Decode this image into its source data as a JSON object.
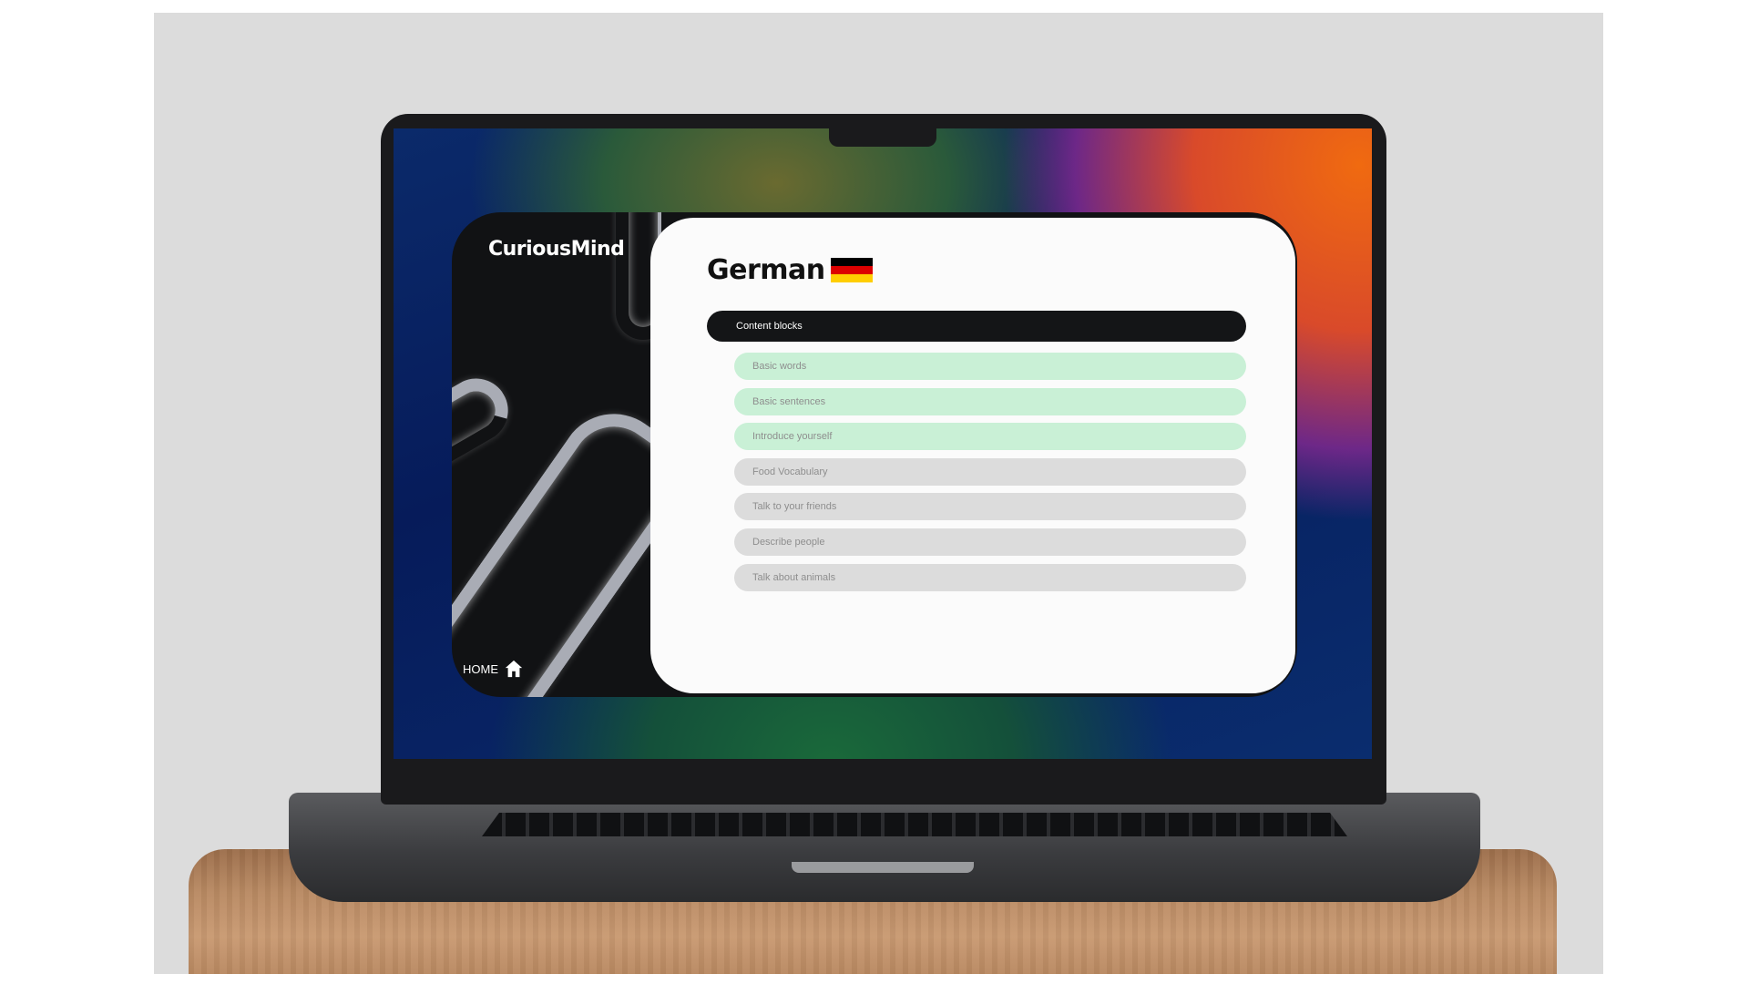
{
  "app": {
    "logo": "CuriousMind",
    "home_label": "HOME"
  },
  "course": {
    "title": "German",
    "flag_colors": [
      "#000000",
      "#dd0000",
      "#ffce00"
    ]
  },
  "section": {
    "label": "Content blocks"
  },
  "blocks": [
    {
      "label": "Basic words",
      "status": "completed"
    },
    {
      "label": "Basic sentences",
      "status": "completed"
    },
    {
      "label": "Introduce yourself",
      "status": "completed"
    },
    {
      "label": "Food Vocabulary",
      "status": "locked"
    },
    {
      "label": "Talk to your friends",
      "status": "locked"
    },
    {
      "label": "Describe people",
      "status": "locked"
    },
    {
      "label": "Talk about animals",
      "status": "locked"
    }
  ],
  "colors": {
    "completed": "#c9f0d6",
    "locked": "#dcdcdc",
    "dark": "#141517"
  }
}
